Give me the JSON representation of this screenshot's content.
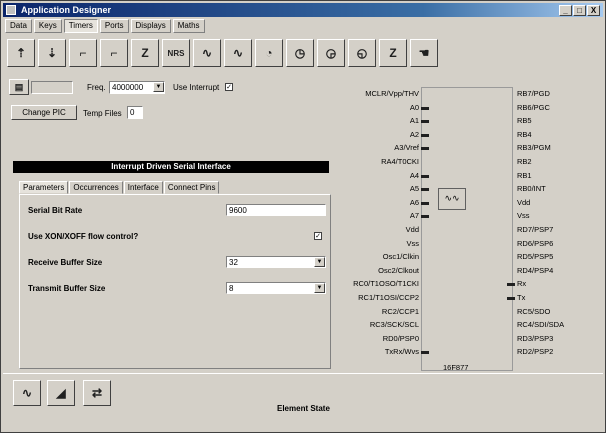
{
  "window": {
    "title": "Application Designer",
    "minimize": "_",
    "maximize": "□",
    "close": "X"
  },
  "menu": [
    "Data",
    "Keys",
    "Timers",
    "Ports",
    "Displays",
    "Maths"
  ],
  "menu_active": 2,
  "toolbar": {
    "buttons": [
      {
        "icon": "plug-in-icon",
        "glyph": "⇡"
      },
      {
        "icon": "plug-out-icon",
        "glyph": "⇣"
      },
      {
        "icon": "pulse-up-icon",
        "glyph": "⌐"
      },
      {
        "icon": "pulse-step-icon",
        "glyph": "⌐"
      },
      {
        "icon": "z-wave-icon",
        "glyph": "Z"
      },
      {
        "icon": "nrs-icon",
        "glyph": "NRS"
      },
      {
        "icon": "pulse-train-icon",
        "glyph": "∿"
      },
      {
        "icon": "pulse-train-2-icon",
        "glyph": "∿"
      },
      {
        "icon": "timer-icon",
        "glyph": "◔"
      },
      {
        "icon": "clock-icon",
        "glyph": "◷"
      },
      {
        "icon": "clock-2-icon",
        "glyph": "◶"
      },
      {
        "icon": "clock-3-icon",
        "glyph": "◵"
      },
      {
        "icon": "counter-icon",
        "glyph": "Z"
      },
      {
        "icon": "hand-icon",
        "glyph": "☚"
      }
    ]
  },
  "config": {
    "freq_label": "Freq.",
    "freq_value": "4000000",
    "use_interrupt_label": "Use Interrupt",
    "use_interrupt_checked": "✓",
    "change_pic": "Change PIC",
    "temp_files_label": "Temp Files",
    "temp_files_value": "0"
  },
  "panel": {
    "banner": "Interrupt Driven Serial Interface",
    "tabs": [
      "Parameters",
      "Occurrences",
      "Interface",
      "Connect Pins"
    ],
    "active_tab": 0,
    "params": [
      {
        "label": "Serial Bit Rate",
        "value": "9600",
        "type": "text"
      },
      {
        "label": "Use XON/XOFF flow control?",
        "value": "✓",
        "type": "check"
      },
      {
        "label": "Receive Buffer Size",
        "value": "32",
        "type": "select"
      },
      {
        "label": "Transmit Buffer Size",
        "value": "8",
        "type": "select"
      }
    ]
  },
  "chip": {
    "name": "16F877",
    "left_pins": [
      "MCLR/Vpp/THV",
      "A0",
      "A1",
      "A2",
      "A3/Vref",
      "RA4/T0CKI",
      "A4",
      "A5",
      "A6",
      "A7",
      "Vdd",
      "Vss",
      "Osc1/Clkin",
      "Osc2/Clkout",
      "RC0/T1OSO/T1CKI",
      "RC1/T1OSI/CCP2",
      "RC2/CCP1",
      "RC3/SCK/SCL",
      "RD0/PSP0",
      "TxRx/Wvs"
    ],
    "right_pins": [
      "RB7/PGD",
      "RB6/PGC",
      "RB5",
      "RB4",
      "RB3/PGM",
      "RB2",
      "RB1",
      "RB0/INT",
      "Vdd",
      "Vss",
      "RD7/PSP7",
      "RD6/PSP6",
      "RD5/PSP5",
      "RD4/PSP4",
      "Rx",
      "Tx",
      "RC5/SDO",
      "RC4/SDI/SDA",
      "RD3/PSP3",
      "RD2/PSP2"
    ]
  },
  "status": {
    "text": "Element State"
  },
  "bottom_icons": [
    "pulse-icon",
    "graph-icon",
    "probe-icon"
  ]
}
